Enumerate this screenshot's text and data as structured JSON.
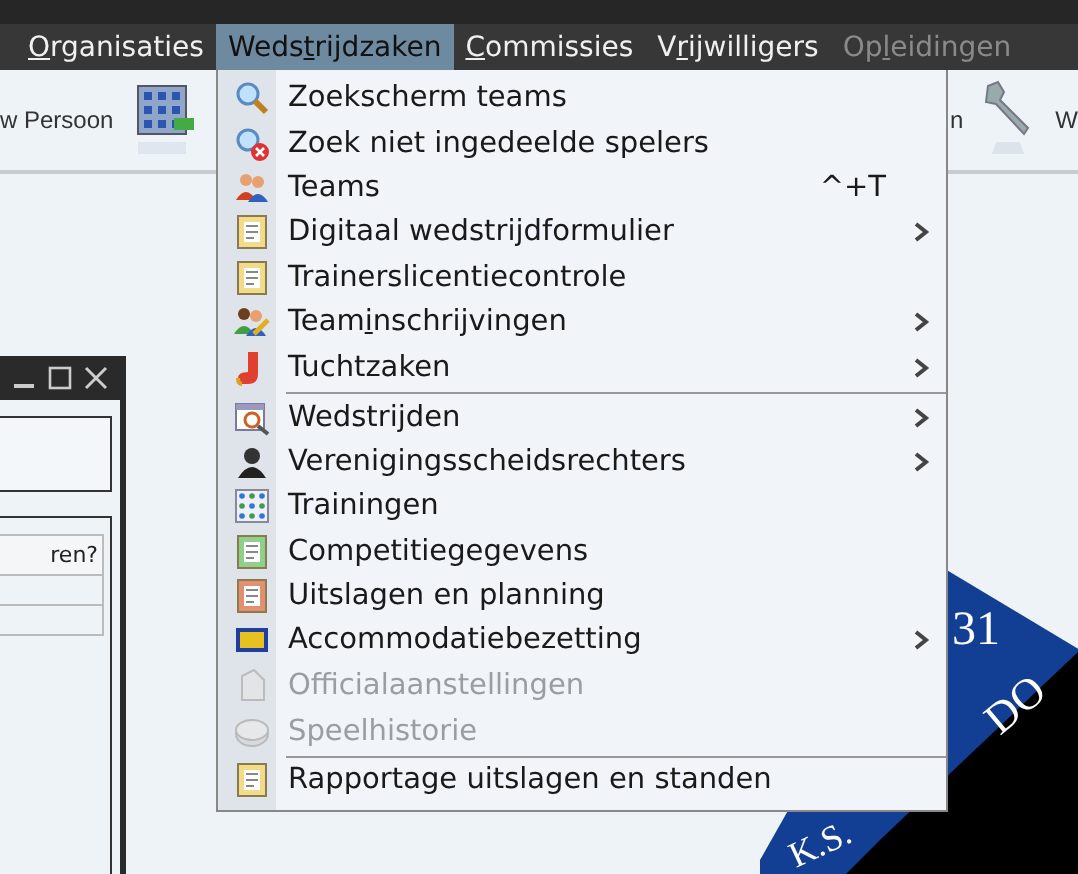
{
  "menubar": [
    {
      "mnemonic": "O",
      "after": "rganisaties",
      "selected": false,
      "disabled": false
    },
    {
      "before": "Weds",
      "mnemonic": "t",
      "after": "rijdzaken",
      "selected": true,
      "disabled": false
    },
    {
      "mnemonic": "C",
      "after": "ommissies",
      "selected": false,
      "disabled": false
    },
    {
      "before": "V",
      "mnemonic": "r",
      "after": "ijwilligers",
      "selected": false,
      "disabled": false
    },
    {
      "before": "Op",
      "mnemonic": "l",
      "after": "eidingen",
      "selected": false,
      "disabled": true
    }
  ],
  "toolbar": {
    "left_label": "w Persoon",
    "right_label": "n",
    "far_label": "W"
  },
  "menu": [
    {
      "kind": "search",
      "label": "Zoekscherm teams",
      "submenu": false,
      "disabled": false,
      "separator_after": false
    },
    {
      "kind": "search-remove",
      "label": "Zoek niet ingedeelde spelers",
      "submenu": false,
      "disabled": false,
      "separator_after": false
    },
    {
      "kind": "people",
      "label": "Teams",
      "shortcut": "^+T",
      "submenu": false,
      "disabled": false,
      "separator_after": false
    },
    {
      "kind": "form",
      "label": "Digitaal wedstrijdformulier",
      "submenu": true,
      "disabled": false,
      "separator_after": false
    },
    {
      "kind": "form",
      "label": "Trainerslicentiecontrole",
      "submenu": false,
      "disabled": false,
      "separator_after": false
    },
    {
      "kind": "people-pencil",
      "before": "Team",
      "mnemonic": "i",
      "after": "nschrijvingen",
      "submenu": true,
      "disabled": false,
      "separator_after": false
    },
    {
      "kind": "boot",
      "label": "Tuchtzaken",
      "submenu": true,
      "disabled": false,
      "separator_after": true
    },
    {
      "kind": "calendar",
      "label": "Wedstrijden",
      "submenu": true,
      "disabled": false,
      "separator_after": false
    },
    {
      "kind": "person",
      "label": "Verenigingsscheidsrechters",
      "submenu": true,
      "disabled": false,
      "separator_after": false
    },
    {
      "kind": "grid",
      "label": "Trainingen",
      "submenu": false,
      "disabled": false,
      "separator_after": false
    },
    {
      "kind": "form-green",
      "label": "Competitiegegevens",
      "submenu": false,
      "disabled": false,
      "separator_after": false
    },
    {
      "kind": "form-red",
      "label": "Uitslagen en planning",
      "submenu": false,
      "disabled": false,
      "separator_after": false
    },
    {
      "kind": "bar",
      "label": "Accommodatiebezetting",
      "submenu": true,
      "disabled": false,
      "separator_after": false
    },
    {
      "kind": "document",
      "label": "Officialaanstellingen",
      "submenu": false,
      "disabled": true,
      "separator_after": false
    },
    {
      "kind": "disk",
      "label": "Speelhistorie",
      "submenu": false,
      "disabled": true,
      "separator_after": true
    },
    {
      "kind": "form",
      "label": "Rapportage uitslagen en standen",
      "submenu": false,
      "disabled": false,
      "separator_after": false
    }
  ],
  "dialog": {
    "column_header": "ren?"
  },
  "logo": {
    "number": "31",
    "word": "DO",
    "initials": "K.S."
  }
}
